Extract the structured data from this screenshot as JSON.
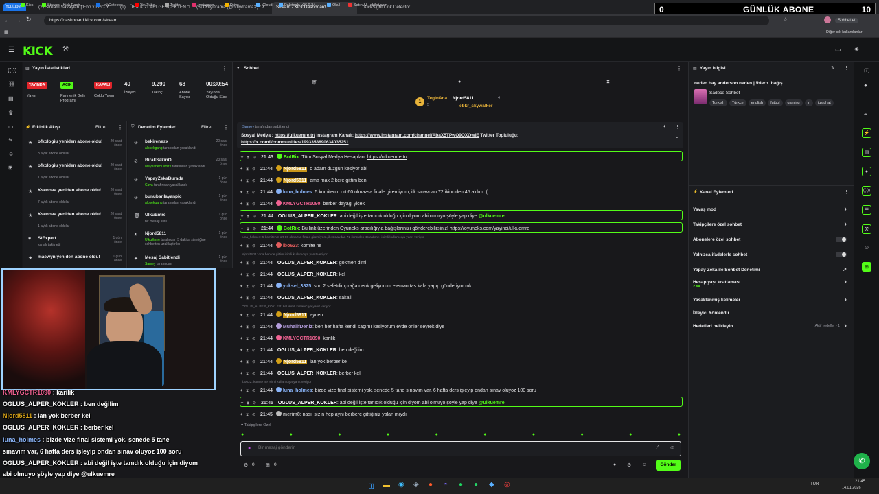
{
  "browser": {
    "tabs": [
      {
        "label": "Youtube"
      },
      {
        "label": "(2) Stream Savaşları | Ebo x Uzi - Y"
      },
      {
        "label": "(1) TÜRK KIZLARI GERÇEKTEN \"K"
      },
      {
        "label": "(5) OnlyDrama (@onlydramaX) / X"
      },
      {
        "label": "Stream - Kick Dashboard"
      },
      {
        "label": "KickSight Link Detector"
      }
    ],
    "url": "https://dashboard.kick.com/stream",
    "bookmarks": [
      "Kick",
      "Stream - Kick Dash...",
      "LinkDetector",
      "YouTube",
      "Twitter",
      "Instagram",
      "Drive",
      "iCloud",
      "Paletools v26.0.24",
      "Okul",
      "Satın Al - obilet.com"
    ],
    "other_bookmarks": "Diğer sık kullanılanlar",
    "chat_button": "Sohbet et",
    "colors": {
      "accent": "#53fc18",
      "bg": "#18181b",
      "panel": "#1b1c1f"
    }
  },
  "abone_overlay": {
    "left": "0",
    "label": "GÜNLÜK ABONE",
    "right": "10"
  },
  "stats": {
    "title": "Yayın İstatistikleri",
    "badges": {
      "live": "YAYINDA",
      "open": "AÇIK",
      "closed": "KAPALI"
    },
    "badge_labels": {
      "live": "Yayın",
      "open": "Partnerlik Gelir Programı",
      "closed": "Çoklu Yayın"
    },
    "numbers": [
      {
        "value": "40",
        "label": "İzleyici"
      },
      {
        "value": "9.290",
        "label": "Takipçi"
      },
      {
        "value": "68",
        "label": "Abone Sayısı"
      },
      {
        "value": "00:30:54",
        "label": "Yayında Olduğu Süre"
      }
    ]
  },
  "activity": {
    "title": "Etkinlik Akışı",
    "filter": "Filtre",
    "items": [
      {
        "title": "ofkologiu yeniden abone oldu!",
        "sub": "8 aylık abone oldular",
        "time": "20 saat önce"
      },
      {
        "title": "ofkologiu yeniden abone oldu!",
        "sub": "1 aylık abone oldular",
        "time": "20 saat önce"
      },
      {
        "title": "Ksenova yeniden abone oldu!",
        "sub": "7 aylık abone oldular",
        "time": "20 saat önce"
      },
      {
        "title": "Ksenova yeniden abone oldu!",
        "sub": "1 aylık abone oldular",
        "time": "20 saat önce"
      },
      {
        "title": "StExpert",
        "sub": "kanalı takip etti",
        "time": "1 gün önce"
      },
      {
        "title": "maewyn yeniden abone oldu!",
        "sub": "",
        "time": "1 gün önce"
      }
    ]
  },
  "moderation": {
    "title": "Denetim Eylemleri",
    "filter": "Filtre",
    "items": [
      {
        "title": "bekirenesx",
        "actor": "alosekgang",
        "sub": "tarafından yasaklandı",
        "time": "20 saat önce"
      },
      {
        "title": "BirakSakinOl",
        "actor": "MeyhaneciDimitri",
        "sub": "tarafından yasaklandı",
        "time": "23 saat önce"
      },
      {
        "title": "YapayZekaBurada",
        "actor": "Cava",
        "sub": "tarafından yasaklandı",
        "time": "1 gün önce"
      },
      {
        "title": "bunubanlayanpic",
        "actor": "alosekgang",
        "sub": "tarafından yasaklandı",
        "time": "1 gün önce"
      },
      {
        "title": "UlkuEmre",
        "actor": "",
        "sub": "bir mesajı sildi",
        "time": "1 gün önce"
      },
      {
        "title": "Njord5811",
        "actor": "UlkuEmre",
        "sub": "tarafından 5 dakika süreliğine sohbetten uzaklaştırıldı",
        "time": "1 gün önce"
      },
      {
        "title": "Mesaj Sabitlendi",
        "actor": "Samey",
        "sub": "tarafından",
        "time": "1 gün önce"
      }
    ]
  },
  "chat": {
    "title": "Sohbet",
    "leaders": [
      {
        "name": "TeginAna",
        "count": "5"
      },
      {
        "name": "Njord5811",
        "count": "4"
      },
      {
        "name": "ebkr_skywalker",
        "count": "1"
      }
    ],
    "pinned": {
      "by_user": "Samey",
      "by_suffix": "tarafından sabitlendi",
      "line1_a": "Sosyal Medya : ",
      "link1": "https://ulkuemre.tr/",
      "line1_b": " Instagram Kanalı: ",
      "link2": "https://www.instagram.com/channel/AbaX5TPwO9OXQwIE",
      "line1_c": " Twitter Topluluğu:",
      "link3": "https://x.com/i/communities/1993358890634035251"
    },
    "messages": [
      {
        "kind": "msg",
        "boxed": true,
        "time": "21:43",
        "user": "BotRix",
        "color": "#53fc18",
        "text": "Tüm Sosyal Medya Hesapları: ",
        "link": "https://ulkuemre.tr/"
      },
      {
        "kind": "msg",
        "time": "21:44",
        "user": "Njord5811",
        "color": "#d4a017",
        "hl": true,
        "text": "o adam düzgün kesiyor abi"
      },
      {
        "kind": "msg",
        "time": "21:44",
        "user": "Njord5811",
        "color": "#d4a017",
        "hl": true,
        "text": "ama max 2 kere gittim ben"
      },
      {
        "kind": "msg",
        "time": "21:44",
        "user": "luna_holmes",
        "color": "#8ab4f8",
        "text": "5 komitenin ort 60 olmazsa finale giremiyom, ilk sınavdan 72 ikinciden 45 aldım :("
      },
      {
        "kind": "msg",
        "time": "21:44",
        "user": "KMLYGCTR1090",
        "color": "#f06292",
        "text": "berber dayagi yicek"
      },
      {
        "kind": "msg",
        "boxed": true,
        "time": "21:44",
        "user": "OGLUS_ALPER_KOKLER",
        "color": "#ffffff",
        "text": "abi değil işte tanıdık olduğu için diyom abi olmuyo şöyle yap diye ",
        "mention": "@ulkuemre"
      },
      {
        "kind": "msg",
        "boxed": true,
        "time": "21:44",
        "user": "BotRix",
        "color": "#53fc18",
        "text": "Bu link üzerinden Oyuneks aracılığıyla bağışlarınızı gönderebilirsiniz! https://oyuneks.com/yayinci/ulkuemre"
      },
      {
        "kind": "reply",
        "text": "luna_holmes: 5 komitenin ort 60 olmazsa finale giremiyom, ilk sınavdan 72 ikinciden 45 aldım :( isimli kullanıcıya yanıt veriyor"
      },
      {
        "kind": "msg",
        "time": "21:44",
        "user": "ibo623",
        "color": "#e35d5d",
        "text": "komite ne"
      },
      {
        "kind": "reply",
        "text": "Njord5811: ona ben de gittim isimli kullanıcıya yanıt veriyor"
      },
      {
        "kind": "msg",
        "time": "21:44",
        "user": "OGLUS_ALPER_KOKLER",
        "color": "#ffffff",
        "text": "gökmen dimi"
      },
      {
        "kind": "msg",
        "time": "21:44",
        "user": "OGLUS_ALPER_KOKLER",
        "color": "#ffffff",
        "text": "kel"
      },
      {
        "kind": "msg",
        "time": "21:44",
        "user": "yuksel_3825",
        "color": "#8ab4f8",
        "text": "son 2 sefetdir çırağa denk geliyorum eleman tas kafa yapıp gönderiyor mk"
      },
      {
        "kind": "msg",
        "time": "21:44",
        "user": "OGLUS_ALPER_KOKLER",
        "color": "#ffffff",
        "text": "sakallı"
      },
      {
        "kind": "reply",
        "text": "OGLUS_ALPER_KOKLER: kel isimli kullanıcıya yanıt veriyor"
      },
      {
        "kind": "msg",
        "time": "21:44",
        "user": "Njord5811",
        "color": "#d4a017",
        "hl": true,
        "text": "aynen"
      },
      {
        "kind": "msg",
        "time": "21:44",
        "user": "MuhalifDeniz",
        "color": "#b39ddb",
        "text": "ben her hafta kendi saçımı kesiyorum evde önler seyrek diye"
      },
      {
        "kind": "msg",
        "time": "21:44",
        "user": "KMLYGCTR1090",
        "color": "#f06292",
        "text": "karilik"
      },
      {
        "kind": "msg",
        "time": "21:44",
        "user": "OGLUS_ALPER_KOKLER",
        "color": "#ffffff",
        "text": "ben değilim"
      },
      {
        "kind": "msg",
        "time": "21:44",
        "user": "Njord5811",
        "color": "#d4a017",
        "hl": true,
        "text": "lan yok berber kel"
      },
      {
        "kind": "msg",
        "time": "21:44",
        "user": "OGLUS_ALPER_KOKLER",
        "color": "#ffffff",
        "text": "berber kel"
      },
      {
        "kind": "reply",
        "text": "ibo622: komite ne isimli kullanıcıya yanıt veriyor"
      },
      {
        "kind": "msg",
        "time": "21:44",
        "user": "luna_holmes",
        "color": "#8ab4f8",
        "text": "bizde vize final sistemi yok, senede 5 tane sınavım var, 6 hafta ders işleyip ondan sınav oluyoz 100 soru"
      },
      {
        "kind": "msg",
        "boxed": true,
        "time": "21:45",
        "user": "OGLUS_ALPER_KOKLER",
        "color": "#ffffff",
        "text": "abi değil işte tanıdık olduğu için diyom abi olmuyo şöyle yap diye ",
        "mention": "@ulkuemre"
      },
      {
        "kind": "msg",
        "time": "21:45",
        "user": "merim8",
        "color": "#bdbdbd",
        "text": "nasıl sızın hep aynı berbere gittiğiniz yalan mıydı"
      }
    ],
    "followers_only": "Takipçilere Özel",
    "input_placeholder": "Bir mesaj gönderin",
    "counts": {
      "a": "0",
      "b": "0"
    },
    "send": "Gönder"
  },
  "stream_info": {
    "title": "Yayın bilgisi",
    "stream_title": "neden bay anderson neden | !blerp !bağış",
    "category": "Sadece Sohbet",
    "tags": [
      "Turkish",
      "Türkçe",
      "english",
      "futbol",
      "gaming",
      "irl",
      "justchat"
    ]
  },
  "channel_actions": {
    "title": "Kanal Eylemleri",
    "items": [
      {
        "label": "Yavaş mod",
        "ctl": "chevron"
      },
      {
        "label": "Takipçilere özel sohbet",
        "ctl": "chevron"
      },
      {
        "label": "Abonelere özel sohbet",
        "ctl": "toggle"
      },
      {
        "label": "Yalnızca ifadelerle sohbet",
        "ctl": "toggle"
      },
      {
        "label": "Yapay Zeka ile Sohbet Denetimi",
        "ctl": "external"
      },
      {
        "label": "Hesap yaşı kısıtlaması",
        "sub": "2 sa.",
        "ctl": "chevron"
      },
      {
        "label": "Yasaklanmış kelimeler",
        "ctl": "chevron"
      },
      {
        "label": "İzleyici Yönlendir",
        "ctl": "none"
      },
      {
        "label": "Hedefleri belirleyin",
        "extra": "Aktif hedefler - 1",
        "ctl": "chevron"
      }
    ]
  },
  "overlay_chat": [
    {
      "user": "KMLYGCTR1090",
      "color": "#f06292",
      "text": " : karilik"
    },
    {
      "user": "OGLUS_ALPER_KOKLER",
      "color": "#ffffff",
      "text": " : ben değilim"
    },
    {
      "user": "Njord5811",
      "color": "#d4a017",
      "text": " : lan yok berber kel"
    },
    {
      "user": "OGLUS_ALPER_KOKLER",
      "color": "#ffffff",
      "text": " : berber kel"
    },
    {
      "user": "luna_holmes",
      "color": "#8ab4f8",
      "text": " : bizde vize final sistemi yok, senede 5 tane"
    },
    {
      "user": "",
      "color": "#ffffff",
      "text": "sınavım var, 6 hafta ders işleyip ondan sınav oluyoz 100 soru"
    },
    {
      "user": "OGLUS_ALPER_KOKLER",
      "color": "#ffffff",
      "text": " : abi değil işte tanıdık olduğu için diyom"
    },
    {
      "user": "",
      "color": "#ffffff",
      "text": "abi olmuyo şöyle yap diye @ulkuemre"
    },
    {
      "user": "merim8",
      "color": "#ffffff",
      "text": " : nasıl sızın hep aynı berbere gittiğiniz yalan mıydı"
    }
  ],
  "taskbar": {
    "lang": "TUR",
    "time": "21:45",
    "date": "14.01.2026"
  }
}
